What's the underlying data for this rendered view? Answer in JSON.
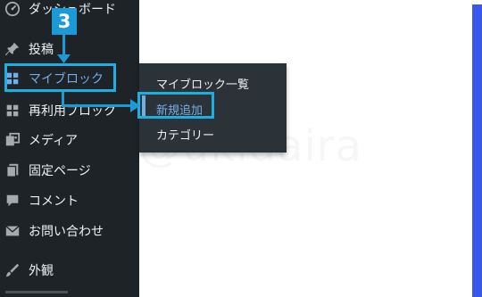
{
  "sidebar": {
    "items": [
      {
        "label": "ダッシュボード",
        "icon": "dashboard-icon"
      },
      {
        "label": "投稿",
        "icon": "pin-icon"
      },
      {
        "label": "マイブロック",
        "icon": "grid-icon"
      },
      {
        "label": "再利用ブロック",
        "icon": "grid-icon"
      },
      {
        "label": "メディア",
        "icon": "media-icon"
      },
      {
        "label": "固定ページ",
        "icon": "page-icon"
      },
      {
        "label": "コメント",
        "icon": "comment-icon"
      },
      {
        "label": "お問い合わせ",
        "icon": "mail-icon"
      },
      {
        "label": "外観",
        "icon": "brush-icon"
      }
    ]
  },
  "flyout": {
    "items": [
      {
        "label": "マイブロック一覧"
      },
      {
        "label": "新規追加"
      },
      {
        "label": "カテゴリー"
      }
    ]
  },
  "annotation": {
    "step": "3"
  },
  "watermark": "@ukidaira",
  "colors": {
    "sidebar_bg": "#1d2327",
    "flyout_bg": "#2c3338",
    "active": "#72aee6",
    "highlight": "#1cb0e2",
    "accent_strip": "#3858e9"
  }
}
